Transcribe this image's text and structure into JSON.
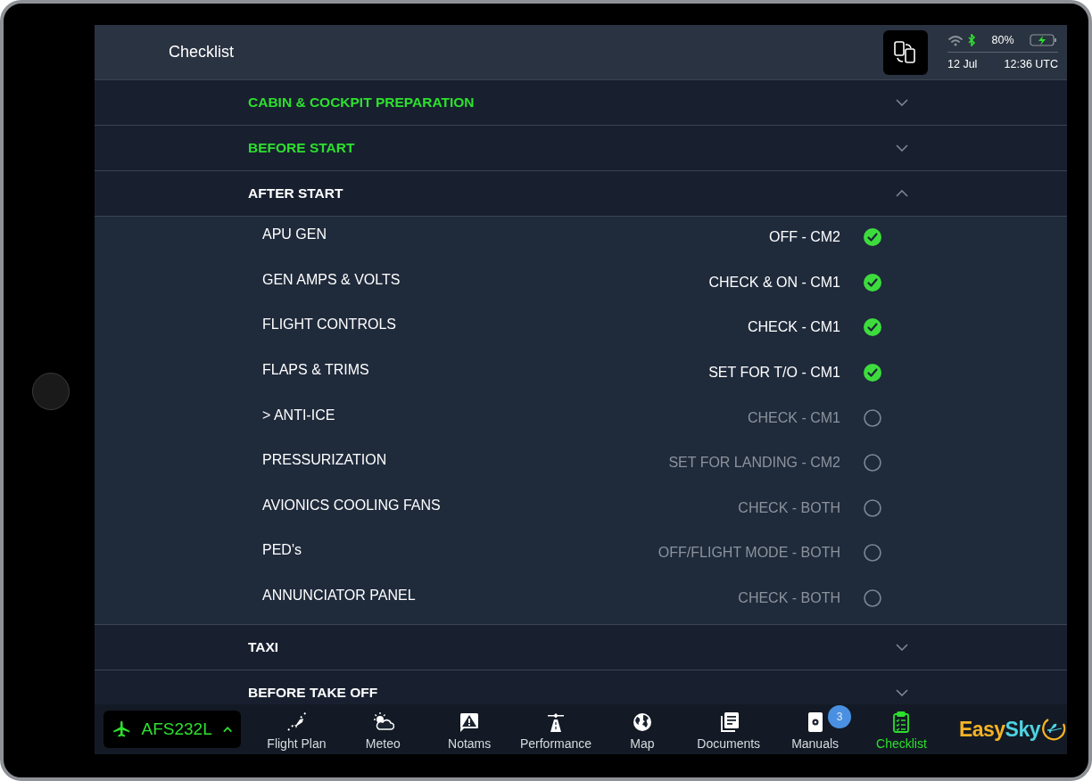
{
  "header": {
    "title": "Checklist",
    "battery": "80%",
    "date": "12 Jul",
    "time": "12:36 UTC"
  },
  "sections": [
    {
      "title": "CABIN & COCKPIT PREPARATION",
      "completed": true,
      "expanded": false
    },
    {
      "title": "BEFORE START",
      "completed": true,
      "expanded": false
    },
    {
      "title": "AFTER START",
      "completed": false,
      "expanded": true,
      "items": [
        {
          "label": "APU GEN",
          "value": "OFF - CM2",
          "checked": true
        },
        {
          "label": "GEN AMPS & VOLTS",
          "value": "CHECK & ON - CM1",
          "checked": true
        },
        {
          "label": "FLIGHT CONTROLS",
          "value": "CHECK - CM1",
          "checked": true
        },
        {
          "label": "FLAPS & TRIMS",
          "value": "SET FOR T/O - CM1",
          "checked": true
        },
        {
          "label": "> ANTI-ICE",
          "value": "CHECK - CM1",
          "checked": false
        },
        {
          "label": "PRESSURIZATION",
          "value": "SET FOR LANDING - CM2",
          "checked": false
        },
        {
          "label": "AVIONICS COOLING FANS",
          "value": "CHECK - BOTH",
          "checked": false
        },
        {
          "label": "PED's",
          "value": "OFF/FLIGHT MODE - BOTH",
          "checked": false
        },
        {
          "label": "ANNUNCIATOR PANEL",
          "value": "CHECK - BOTH",
          "checked": false
        }
      ]
    },
    {
      "title": "TAXI",
      "completed": false,
      "expanded": false
    },
    {
      "title": "BEFORE TAKE OFF",
      "completed": false,
      "expanded": false
    }
  ],
  "flight": {
    "callsign": "AFS232L"
  },
  "nav": [
    {
      "label": "Flight Plan",
      "kind": "plan",
      "selected": false
    },
    {
      "label": "Meteo",
      "kind": "meteo",
      "selected": false
    },
    {
      "label": "Notams",
      "kind": "notams",
      "selected": false
    },
    {
      "label": "Performance",
      "kind": "performance",
      "selected": false
    },
    {
      "label": "Map",
      "kind": "map",
      "selected": false
    },
    {
      "label": "Documents",
      "kind": "documents",
      "selected": false
    },
    {
      "label": "Manuals",
      "kind": "manuals",
      "selected": false,
      "badge": "3"
    },
    {
      "label": "Checklist",
      "kind": "checklist",
      "selected": true
    }
  ],
  "logo": {
    "text_1": "Easy",
    "text_2": "Sky"
  }
}
